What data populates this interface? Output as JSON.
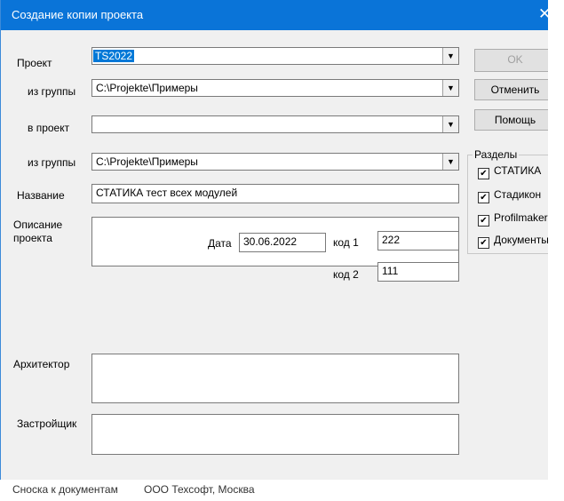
{
  "window": {
    "title": "Создание копии проекта",
    "close_glyph": "✕"
  },
  "form": {
    "project_label": "Проект",
    "project_value": "TS2022",
    "from_group_label": "из группы",
    "from_group_value": "C:\\Projekte\\Примеры",
    "to_project_label": "в проект",
    "to_project_value": "",
    "to_group_label": "из группы",
    "to_group_value": "C:\\Projekte\\Примеры",
    "name_label": "Название",
    "name_value": "СТАТИКА тест всех модулей",
    "description_label": "Описание проекта",
    "description_value": "",
    "date_label": "Дата",
    "date_value": "30.06.2022",
    "code1_label": "код 1",
    "code1_value": "222",
    "code2_label": "код 2",
    "code2_value": "111",
    "architect_label": "Архитектор",
    "architect_value": "",
    "developer_label": "Застройщик",
    "developer_value": "",
    "doc_ref_label": "Сноска к документам",
    "doc_ref_value": "ООО Техсофт, Москва"
  },
  "buttons": {
    "ok": "OK",
    "cancel": "Отменить",
    "help": "Помощь"
  },
  "sections": {
    "title": "Разделы",
    "items": [
      {
        "label": "СТАТИКА",
        "checked": true
      },
      {
        "label": "Стадикон",
        "checked": true
      },
      {
        "label": "Profilmaker",
        "checked": true
      },
      {
        "label": "Документы",
        "checked": true
      }
    ],
    "check_glyph": "✔"
  },
  "colors": {
    "titlebar": "#0a74d8",
    "selection": "#0078d7",
    "dialog_bg": "#f0f0f0"
  }
}
